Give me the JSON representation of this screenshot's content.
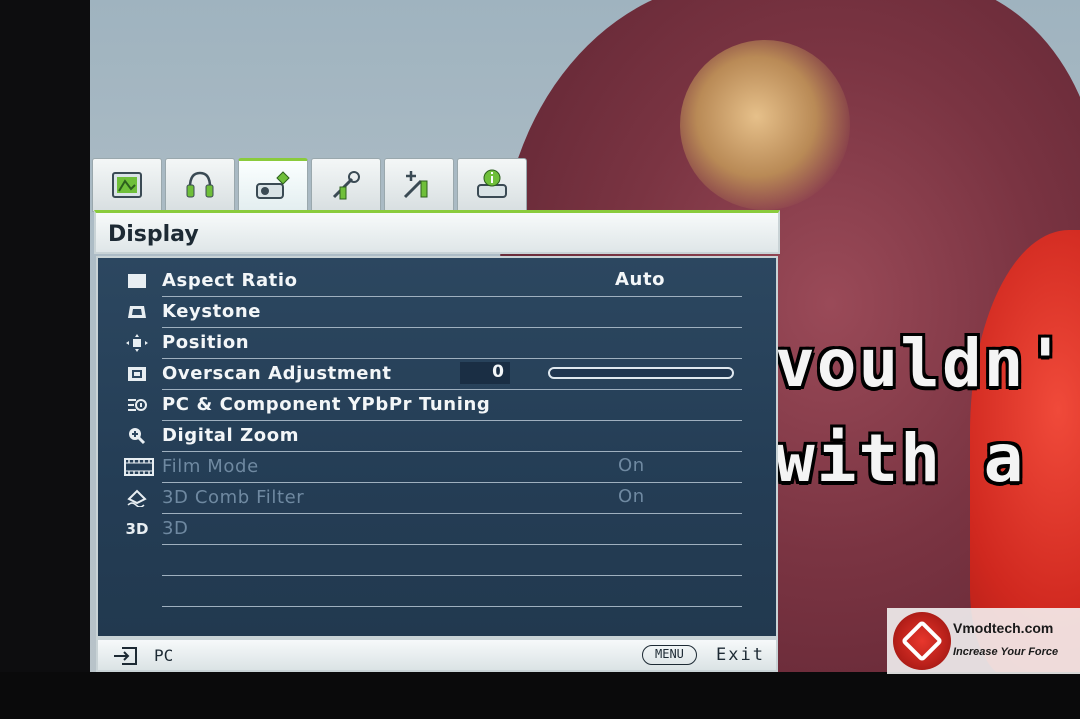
{
  "osd": {
    "tabs": [
      {
        "icon": "picture-settings-icon",
        "active": false
      },
      {
        "icon": "audio-settings-icon",
        "active": false
      },
      {
        "icon": "display-settings-icon",
        "active": true
      },
      {
        "icon": "system-setup-basic-icon",
        "active": false
      },
      {
        "icon": "system-setup-advanced-icon",
        "active": false
      },
      {
        "icon": "information-icon",
        "active": false
      }
    ],
    "title": "Display",
    "items": [
      {
        "icon": "aspect-ratio-icon",
        "label": "Aspect Ratio",
        "value": "Auto",
        "enabled": true
      },
      {
        "icon": "keystone-icon",
        "label": "Keystone",
        "value": "",
        "enabled": true
      },
      {
        "icon": "position-icon",
        "label": "Position",
        "value": "",
        "enabled": true
      },
      {
        "icon": "overscan-icon",
        "label": "Overscan Adjustment",
        "value": "0",
        "level": 0.0,
        "enabled": true
      },
      {
        "icon": "pc-tuning-icon",
        "label": "PC & Component YPbPr Tuning",
        "value": "",
        "enabled": true
      },
      {
        "icon": "digital-zoom-icon",
        "label": "Digital Zoom",
        "value": "",
        "enabled": true
      },
      {
        "icon": "film-mode-icon",
        "label": "Film Mode",
        "value": "On",
        "enabled": false
      },
      {
        "icon": "comb-filter-icon",
        "label": "3D Comb Filter",
        "value": "On",
        "enabled": false
      },
      {
        "icon": "3d-icon",
        "icon_text": "3D",
        "label": "3D",
        "value": "",
        "enabled": false
      }
    ],
    "footer": {
      "source_label": "PC",
      "menu_key": "MENU",
      "exit_label": "Exit"
    }
  },
  "video": {
    "subtitle_line1": "vouldn'",
    "subtitle_line2": "with a"
  },
  "watermark": {
    "title": "Vmodtech.com",
    "slogan": "Increase Your Force"
  },
  "colors": {
    "accent": "#8acb3c",
    "menu_bg": "#2c4760",
    "text": "#f3f6f8",
    "disabled_text": "#6f89a1"
  }
}
